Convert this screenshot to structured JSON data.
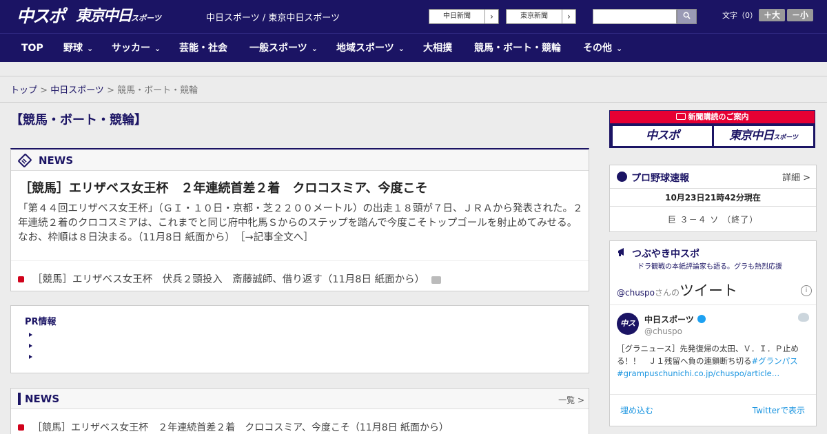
{
  "header": {
    "logo_chuspo": "中スポ",
    "logo_tokyo": "東京中日",
    "logo_tokyo_sub": "スポーツ",
    "site_links": "中日スポーツ / 東京中日スポーツ",
    "paper_buttons": [
      {
        "label": "中日新聞",
        "arrow": "›"
      },
      {
        "label": "東京新聞",
        "arrow": "›"
      }
    ],
    "search": {
      "placeholder": "",
      "button_icon": "search-icon"
    },
    "font_size_label": "文字（0）",
    "font_large": "＋大",
    "font_small": "－小"
  },
  "nav": [
    {
      "label": "TOP",
      "dropdown": false
    },
    {
      "label": "野球",
      "dropdown": true
    },
    {
      "label": "サッカー",
      "dropdown": true
    },
    {
      "label": "芸能・社会",
      "dropdown": false
    },
    {
      "label": "一般スポーツ",
      "dropdown": true
    },
    {
      "label": "地域スポーツ",
      "dropdown": true
    },
    {
      "label": "大相撲",
      "dropdown": false
    },
    {
      "label": "競馬・ボート・競輪",
      "dropdown": false
    },
    {
      "label": "その他",
      "dropdown": true
    }
  ],
  "nav_chevron": "⌄",
  "breadcrumb": {
    "top": "トップ",
    "sep": " > ",
    "chunichi": "中日スポーツ",
    "current": "競馬・ボート・競輪"
  },
  "page_title": "【競馬・ボート・競輪】",
  "news": {
    "label": "NEWS",
    "headline": "［競馬］エリザベス女王杯　２年連続首差２着　クロコスミア、今度こそ",
    "summary": "「第４４回エリザベス女王杯」（ＧＩ・１０日・京都・芝２２００メートル）の出走１８頭が７日、ＪＲＡから発表された。２年連続２着のクロコスミアは、これまでと同じ府中牝馬Ｓからのステップを踏んで今度こそトップゴールを射止めてみせる。なお、枠順は８日決まる。（11月8日 紙面から）",
    "read_more": "［→記事全文へ］",
    "related": "［競馬］エリザベス女王杯　伏兵２頭投入　斎藤誠師、借り返す（11月8日 紙面から）"
  },
  "pr": {
    "title": "PR情報"
  },
  "news2": {
    "label": "NEWS",
    "more": "一覧 >",
    "item": "［競馬］エリザベス女王杯　２年連続首差２着　クロコスミア、今度こそ（11月8日 紙面から）"
  },
  "subscription": {
    "banner": "新聞購読のご案内",
    "logo_chuspo": "中スポ",
    "logo_tokyo": "東京中日",
    "logo_tokyo_sub": "スポーツ"
  },
  "baseball": {
    "title": "プロ野球速報",
    "detail": "詳細 >",
    "time": "10月23日21時42分現在",
    "score": "巨 ３－４ ソ （終了）"
  },
  "twitter": {
    "title": "つぶやき中スポ",
    "subtitle": "ドラ観戦の本紙評論家も語る。グラも熱烈応援",
    "header_handle": "@chuspo",
    "header_san": "さんの",
    "header_tweet": "ツイート",
    "info": "i",
    "avatar_text": "中スポ",
    "name": "中日スポーツ",
    "handle": "@chuspo",
    "text": "［グラニュース］先発復帰の太田、Ｖ．Ｉ．Ｐ止める！！　Ｊ１残留へ負の連鎖断ち切る",
    "hashtag": "#グランパス",
    "link": "#grampuschunichi.co.jp/chuspo/article…",
    "embed": "埋め込む",
    "view": "Twitterで表示"
  },
  "colors": {
    "brand": "#1b1464",
    "accent_red": "#e60033",
    "twitter_blue": "#1b95e0"
  }
}
